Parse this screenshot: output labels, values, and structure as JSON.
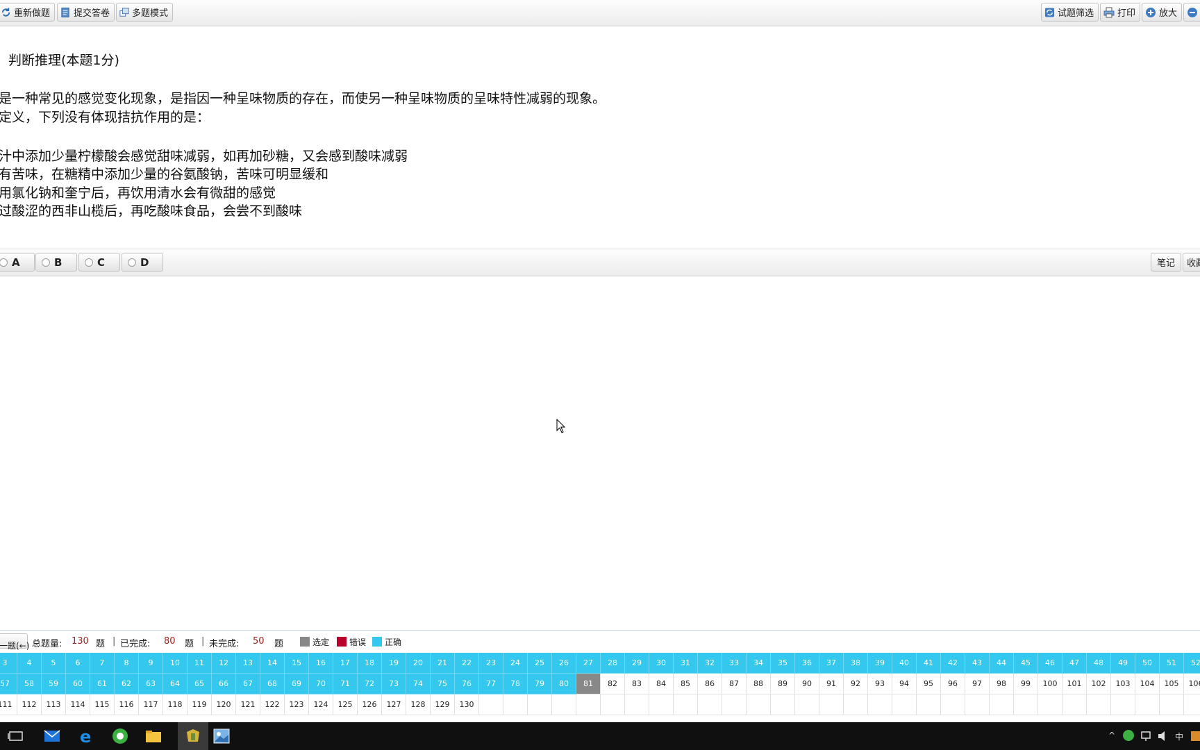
{
  "toolbar": {
    "redo_label": "重新做题",
    "submit_label": "提交答卷",
    "multi_label": "多题模式",
    "filter_label": "试题筛选",
    "print_label": "打印",
    "zoom_in_label": "放大"
  },
  "question": {
    "header": "判断推理(本题1分)",
    "line1": "是一种常见的感觉变化现象，是指因一种呈味物质的存在，而使另一种呈味物质的呈味特性减弱的现象。",
    "line2": "定义，下列没有体现拮抗作用的是：",
    "options": [
      "汁中添加少量柠檬酸会感觉甜味减弱，如再加砂糖，又会感到酸味减弱",
      "有苦味，在糖精中添加少量的谷氨酸钠，苦味可明显缓和",
      "用氯化钠和奎宁后，再饮用清水会有微甜的感觉",
      "过酸涩的西非山榄后，再吃酸味食品，会尝不到酸味"
    ]
  },
  "answers": {
    "choices": [
      "A",
      "B",
      "C",
      "D"
    ],
    "notes_label": "笔记",
    "fav_label": "收藏"
  },
  "status": {
    "prev_label": "一题(←)",
    "total_label": "总题量:",
    "total_value": "130",
    "unit": "题",
    "done_label": "已完成:",
    "done_value": "80",
    "undone_label": "未完成:",
    "undone_value": "50",
    "legend_selected": "选定",
    "legend_wrong": "错误",
    "legend_correct": "正确"
  },
  "colors": {
    "correct": "#34c8ee",
    "wrong": "#b8002a",
    "selected": "#888888"
  },
  "grid": {
    "rows": [
      {
        "start": 3,
        "end": 52
      },
      {
        "start": 57,
        "end": 106
      },
      {
        "start": 111,
        "end": 130
      }
    ],
    "completed_max": 80,
    "selected": 81
  },
  "taskbar": {
    "ime": "中"
  }
}
